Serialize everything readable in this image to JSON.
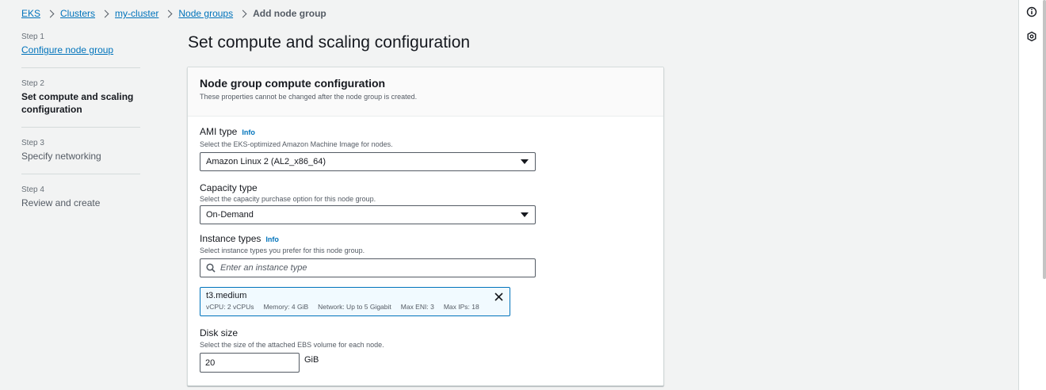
{
  "breadcrumb": {
    "items": [
      "EKS",
      "Clusters",
      "my-cluster",
      "Node groups"
    ],
    "current": "Add node group"
  },
  "steps": [
    {
      "num": "Step 1",
      "label": "Configure node group"
    },
    {
      "num": "Step 2",
      "label": "Set compute and scaling configuration"
    },
    {
      "num": "Step 3",
      "label": "Specify networking"
    },
    {
      "num": "Step 4",
      "label": "Review and create"
    }
  ],
  "page_title": "Set compute and scaling configuration",
  "panel": {
    "title": "Node group compute configuration",
    "description": "These properties cannot be changed after the node group is created."
  },
  "ami": {
    "label": "AMI type",
    "info": "Info",
    "description": "Select the EKS-optimized Amazon Machine Image for nodes.",
    "value": "Amazon Linux 2 (AL2_x86_64)"
  },
  "capacity": {
    "label": "Capacity type",
    "description": "Select the capacity purchase option for this node group.",
    "value": "On-Demand"
  },
  "instance_types": {
    "label": "Instance types",
    "info": "Info",
    "description": "Select instance types you prefer for this node group.",
    "placeholder": "Enter an instance type",
    "selected": {
      "name": "t3.medium",
      "vcpu": "vCPU: 2 vCPUs",
      "memory": "Memory: 4 GiB",
      "network": "Network: Up to 5 Gigabit",
      "eni": "Max ENI: 3",
      "ips": "Max IPs: 18"
    }
  },
  "disk": {
    "label": "Disk size",
    "description": "Select the size of the attached EBS volume for each node.",
    "value": "20",
    "unit": "GiB"
  },
  "colors": {
    "link": "#0073bb",
    "background": "#f2f3f3",
    "token_bg": "#f1faff"
  },
  "icons": [
    "chevron-right-icon",
    "search-icon",
    "close-icon",
    "info-icon",
    "settings-icon",
    "caret-down-icon"
  ]
}
